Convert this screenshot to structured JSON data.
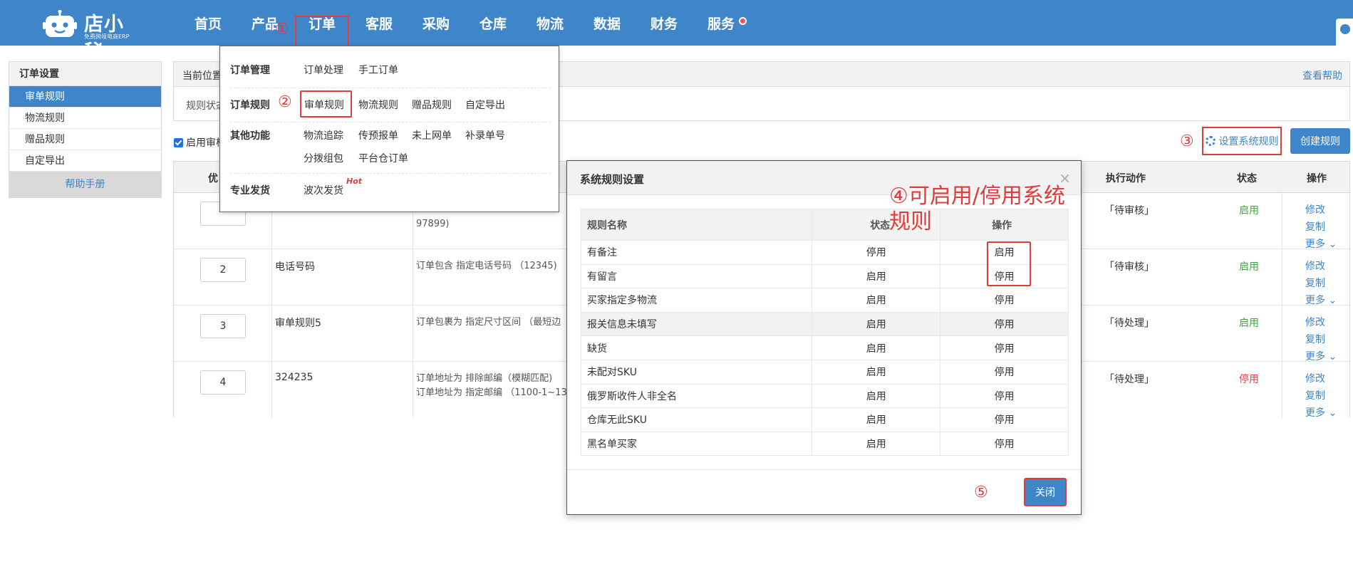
{
  "brand": {
    "name": "店小秘",
    "tagline": "免费跨境电商ERP"
  },
  "nav": {
    "items": [
      "首页",
      "产品",
      "订单",
      "客服",
      "采购",
      "仓库",
      "物流",
      "数据",
      "财务",
      "服务"
    ],
    "active": "订单"
  },
  "annotations": {
    "n1": "①",
    "n2": "②",
    "n3": "③",
    "n4": "④可启用/停用系统规则",
    "n5": "⑤"
  },
  "sidebar": {
    "title": "订单设置",
    "items": [
      "审单规则",
      "物流规则",
      "赠品规则",
      "自定导出"
    ],
    "active": "审单规则",
    "help": "帮助手册"
  },
  "main": {
    "breadcrumb": "当前位置",
    "help_link": "查看帮助",
    "filter_label": "规则状态",
    "enable_label": "启用审核",
    "sys_rule_button": "设置系统规则",
    "create_button": "创建规则",
    "columns": [
      "优",
      "执行动作",
      "状态",
      "操作"
    ]
  },
  "rules": [
    {
      "priority": "",
      "name": "",
      "condition": [
        "97899)"
      ],
      "action": "「待审核」",
      "status": "启用",
      "ops": [
        "修改",
        "复制",
        "更多"
      ]
    },
    {
      "priority": "2",
      "name": "电话号码",
      "condition": [
        "订单包含 指定电话号码 （12345)"
      ],
      "action": "「待审核」",
      "status": "启用",
      "ops": [
        "修改",
        "复制",
        "更多"
      ]
    },
    {
      "priority": "3",
      "name": "审单规则5",
      "condition": [
        "订单包裹为 指定尺寸区间 （最短边"
      ],
      "action": "「待处理」",
      "status": "启用",
      "ops": [
        "修改",
        "复制",
        "更多"
      ]
    },
    {
      "priority": "4",
      "name": "324235",
      "condition": [
        "订单地址为 排除邮编（模糊匹配)",
        "订单地址为 指定邮编 （1100-1~13"
      ],
      "action": "「待处理」",
      "status": "停用",
      "ops": [
        "修改",
        "复制",
        "更多"
      ]
    }
  ],
  "dropdown": {
    "order_mgmt": {
      "label": "订单管理",
      "links": [
        "订单处理",
        "手工订单"
      ]
    },
    "order_rules": {
      "label": "订单规则",
      "links": [
        "审单规则",
        "物流规则",
        "赠品规则",
        "自定导出"
      ]
    },
    "other": {
      "label": "其他功能",
      "links": [
        "物流追踪",
        "传预报单",
        "未上网单",
        "补录单号",
        "分拨组包",
        "平台仓订单"
      ]
    },
    "pro": {
      "label": "专业发货",
      "links": [
        "波次发货"
      ],
      "badge": "Hot"
    }
  },
  "modal": {
    "title": "系统规则设置",
    "close_symbol": "×",
    "columns": [
      "规则名称",
      "状态",
      "操作"
    ],
    "rows": [
      {
        "name": "有备注",
        "status": "停用",
        "action": "启用"
      },
      {
        "name": "有留言",
        "status": "启用",
        "action": "停用"
      },
      {
        "name": "买家指定多物流",
        "status": "启用",
        "action": "停用"
      },
      {
        "name": "报关信息未填写",
        "status": "启用",
        "action": "停用"
      },
      {
        "name": "缺货",
        "status": "启用",
        "action": "停用"
      },
      {
        "name": "未配对SKU",
        "status": "启用",
        "action": "停用"
      },
      {
        "name": "俄罗斯收件人非全名",
        "status": "启用",
        "action": "停用"
      },
      {
        "name": "仓库无此SKU",
        "status": "启用",
        "action": "停用"
      },
      {
        "name": "黑名单买家",
        "status": "启用",
        "action": "停用"
      }
    ],
    "close_button": "关闭"
  },
  "colors": {
    "primary": "#3e86c9",
    "enabled": "#3aa83a",
    "disabled": "#e03c3c",
    "annotation": "#e03c3c"
  }
}
